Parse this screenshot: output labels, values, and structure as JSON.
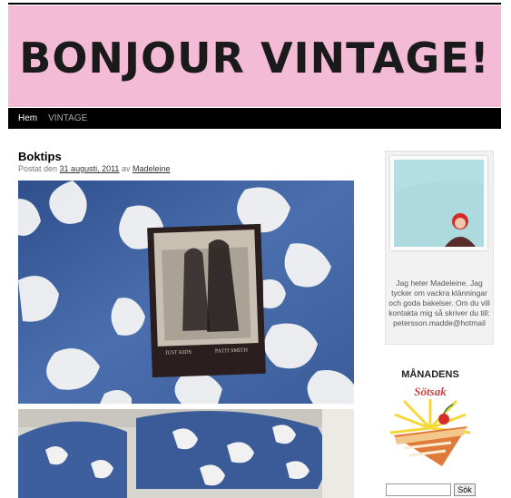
{
  "site": {
    "title": "BONJOUR VINTAGE!"
  },
  "nav": {
    "items": [
      {
        "label": "Hem"
      },
      {
        "label": "VINTAGE"
      }
    ]
  },
  "post": {
    "title": "Boktips",
    "meta_prefix": "Postat den",
    "date": "31 augusti, 2011",
    "by": "av",
    "author": "Madeleine",
    "book_title_left": "JUST KIDS",
    "book_title_right": "PATTI SMITH"
  },
  "sidebar": {
    "about": "Jag heter Madeleine. Jag tycker om vackra klänningar och goda bakelser. Om du vill kontakta mig så skriver du till: petersson.madde@hotmail",
    "badge_line1": "MÅNADENS",
    "badge_line2": "Sötsak"
  },
  "search": {
    "placeholder": "",
    "button_label": "Sök"
  },
  "colors": {
    "banner": "#f3bbd6",
    "nav": "#000000",
    "fabric": "#3d5f9f"
  }
}
